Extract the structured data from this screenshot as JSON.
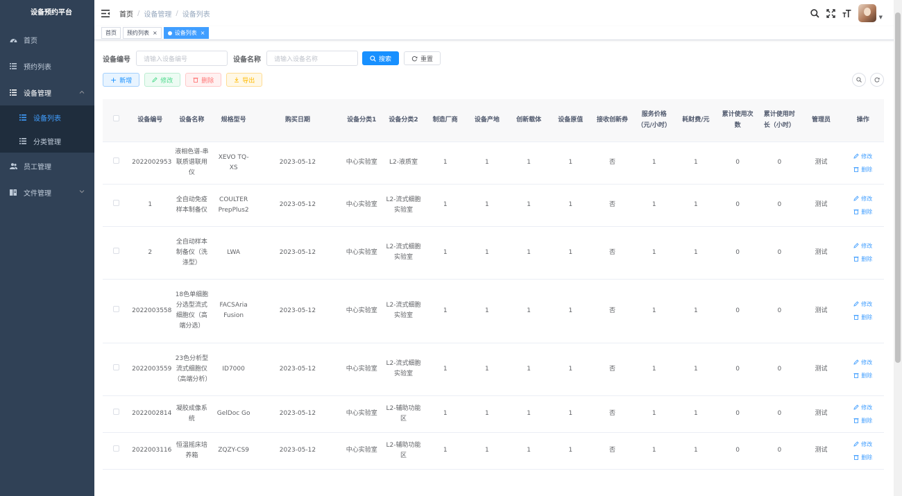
{
  "sidebar": {
    "title": "设备预约平台",
    "items": [
      {
        "label": "首页"
      },
      {
        "label": "预约列表"
      },
      {
        "label": "设备管理"
      },
      {
        "label": "员工管理"
      },
      {
        "label": "文件管理"
      }
    ],
    "sub_items": [
      {
        "label": "设备列表"
      },
      {
        "label": "分类管理"
      }
    ]
  },
  "navbar": {
    "breadcrumb": [
      "首页",
      "设备管理",
      "设备列表"
    ],
    "separator": "/"
  },
  "tags": [
    {
      "label": "首页"
    },
    {
      "label": "预约列表",
      "close": "×"
    },
    {
      "label": "设备列表",
      "close": "×"
    }
  ],
  "search": {
    "code_label": "设备编号",
    "code_placeholder": "请输入设备编号",
    "name_label": "设备名称",
    "name_placeholder": "请输入设备名称",
    "search_label": "搜索",
    "reset_label": "重置"
  },
  "toolbar": {
    "add_label": "新增",
    "edit_label": "修改",
    "delete_label": "删除",
    "export_label": "导出"
  },
  "table": {
    "columns": [
      "设备编号",
      "设备名称",
      "规格型号",
      "购买日期",
      "设备分类1",
      "设备分类2",
      "制造厂商",
      "设备产地",
      "创新载体",
      "设备原值",
      "接收创新券",
      "服务价格（元/小时）",
      "耗财费/元",
      "累计使用次数",
      "累计使用时长（小时）",
      "管理员",
      "操作"
    ],
    "edit_label": "修改",
    "delete_label": "删除",
    "rows": [
      [
        "2022002953",
        "液相色谱-串联质谱联用仪",
        "XEVO TQ-XS",
        "2023-05-12",
        "中心实验室",
        "L2-液质室",
        "1",
        "1",
        "1",
        "1",
        "否",
        "1",
        "1",
        "0",
        "0",
        "测试"
      ],
      [
        "1",
        "全自动免疫样本制备仪",
        "COULTER PrepPlus2",
        "2023-05-12",
        "中心实验室",
        "L2-流式细胞实验室",
        "1",
        "1",
        "1",
        "1",
        "否",
        "1",
        "1",
        "0",
        "0",
        "测试"
      ],
      [
        "2",
        "全自动样本制备仪（洗涤型）",
        "LWA",
        "2023-05-12",
        "中心实验室",
        "L2-流式细胞实验室",
        "1",
        "1",
        "1",
        "1",
        "否",
        "1",
        "1",
        "0",
        "0",
        "测试"
      ],
      [
        "2022003558",
        "18色单细胞分选型流式细胞仪（高端分选）",
        "FACSAria Fusion",
        "2023-05-12",
        "中心实验室",
        "L2-流式细胞实验室",
        "1",
        "1",
        "1",
        "1",
        "否",
        "1",
        "1",
        "0",
        "0",
        "测试"
      ],
      [
        "2022003559",
        "23色分析型流式细胞仪（高端分析）",
        "ID7000",
        "2023-05-12",
        "中心实验室",
        "L2-流式细胞实验室",
        "1",
        "1",
        "1",
        "1",
        "否",
        "1",
        "1",
        "0",
        "0",
        "测试"
      ],
      [
        "2022002814",
        "凝胶成像系统",
        "GelDoc Go",
        "2023-05-12",
        "中心实验室",
        "L2-辅助功能区",
        "1",
        "1",
        "1",
        "1",
        "否",
        "1",
        "1",
        "0",
        "0",
        "测试"
      ],
      [
        "2022003116",
        "恒温摇床培养箱",
        "ZQZY-CS9",
        "2023-05-12",
        "中心实验室",
        "L2-辅助功能区",
        "1",
        "1",
        "1",
        "1",
        "否",
        "1",
        "1",
        "0",
        "0",
        "测试"
      ]
    ]
  }
}
